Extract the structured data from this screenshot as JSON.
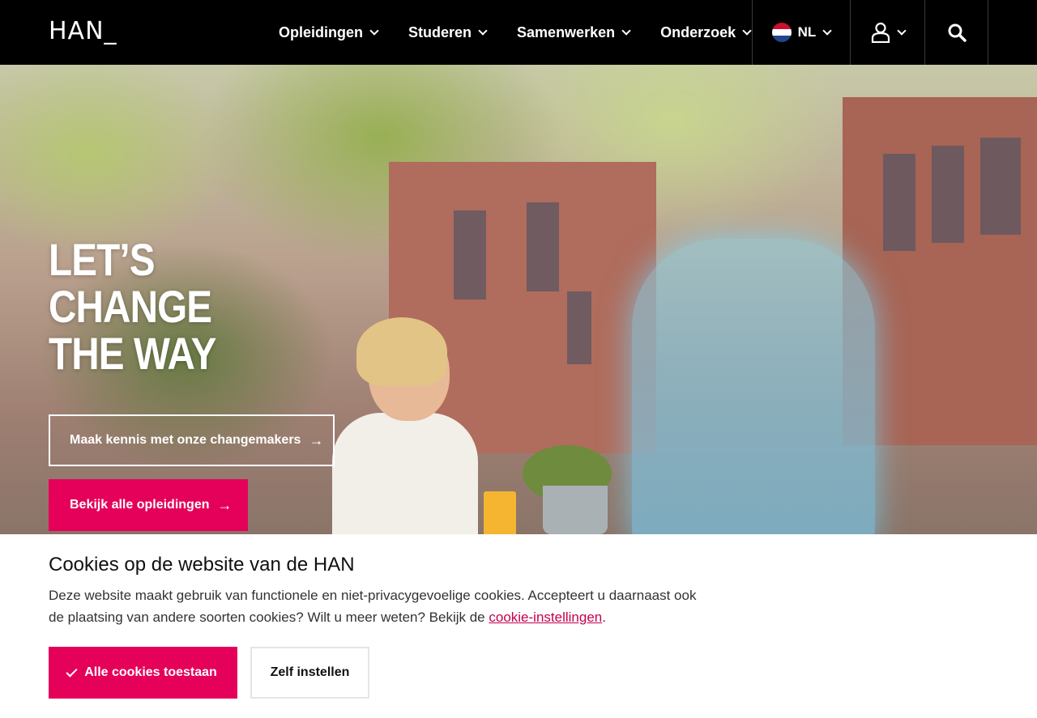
{
  "header": {
    "logo": "HAN_",
    "nav": [
      {
        "label": "Opleidingen"
      },
      {
        "label": "Studeren"
      },
      {
        "label": "Samenwerken"
      },
      {
        "label": "Onderzoek"
      }
    ],
    "language": "NL",
    "flag_colors": [
      "#c8102e",
      "#ffffff",
      "#21468b"
    ]
  },
  "hero": {
    "title_lines": [
      "LET’S",
      "CHANGE",
      "THE WAY"
    ],
    "secondary_button": "Maak kennis met onze changemakers",
    "primary_button": "Bekijk alle opleidingen",
    "accent_color": "#e5005a"
  },
  "cookie": {
    "title": "Cookies op de website van de HAN",
    "text_before_link": "Deze website maakt gebruik van functionele en niet-privacygevoelige cookies. Accepteert u daarnaast ook de plaatsing van andere soorten cookies? Wilt u meer weten? Bekijk de ",
    "link_text": "cookie-instellingen",
    "text_after_link": ".",
    "accept_button": "Alle cookies toestaan",
    "settings_button": "Zelf instellen"
  }
}
